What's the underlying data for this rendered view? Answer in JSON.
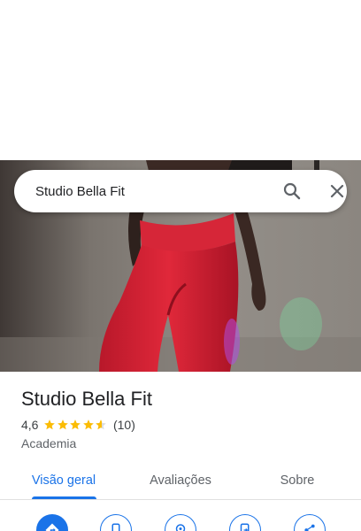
{
  "search": {
    "query": "Studio Bella Fit"
  },
  "place": {
    "title": "Studio Bella Fit",
    "rating": "4,6",
    "rating_value": 4.6,
    "review_count": "(10)",
    "category": "Academia"
  },
  "tabs": [
    {
      "label": "Visão geral",
      "active": true
    },
    {
      "label": "Avaliações",
      "active": false
    },
    {
      "label": "Sobre",
      "active": false
    }
  ],
  "actions": [
    {
      "icon": "directions-icon"
    },
    {
      "icon": "phone-icon"
    },
    {
      "icon": "nearby-icon"
    },
    {
      "icon": "send-to-phone-icon"
    },
    {
      "icon": "share-icon"
    }
  ],
  "colors": {
    "accent": "#1a73e8",
    "star": "#fbbc04",
    "text": "#202124",
    "muted": "#5f6368"
  }
}
